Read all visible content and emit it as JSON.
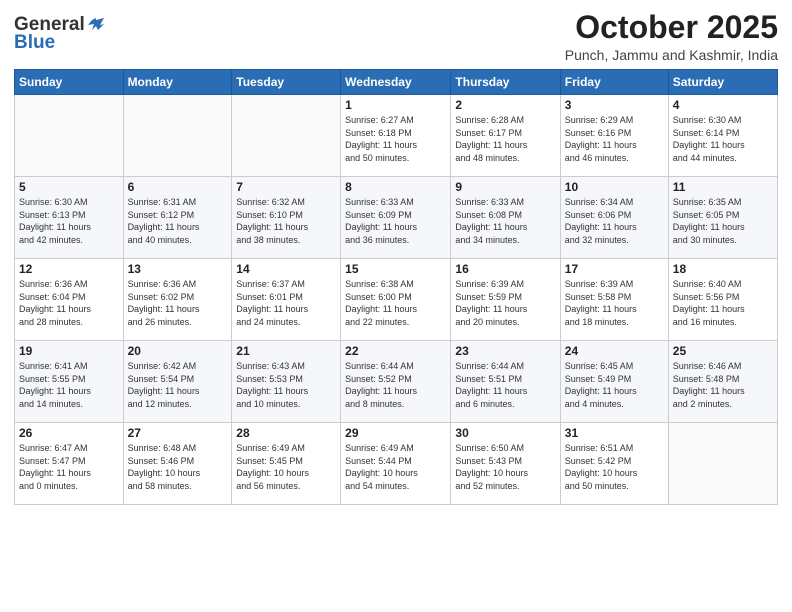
{
  "header": {
    "logo_general": "General",
    "logo_blue": "Blue",
    "month_title": "October 2025",
    "subtitle": "Punch, Jammu and Kashmir, India"
  },
  "days_of_week": [
    "Sunday",
    "Monday",
    "Tuesday",
    "Wednesday",
    "Thursday",
    "Friday",
    "Saturday"
  ],
  "weeks": [
    [
      {
        "num": "",
        "info": ""
      },
      {
        "num": "",
        "info": ""
      },
      {
        "num": "",
        "info": ""
      },
      {
        "num": "1",
        "info": "Sunrise: 6:27 AM\nSunset: 6:18 PM\nDaylight: 11 hours\nand 50 minutes."
      },
      {
        "num": "2",
        "info": "Sunrise: 6:28 AM\nSunset: 6:17 PM\nDaylight: 11 hours\nand 48 minutes."
      },
      {
        "num": "3",
        "info": "Sunrise: 6:29 AM\nSunset: 6:16 PM\nDaylight: 11 hours\nand 46 minutes."
      },
      {
        "num": "4",
        "info": "Sunrise: 6:30 AM\nSunset: 6:14 PM\nDaylight: 11 hours\nand 44 minutes."
      }
    ],
    [
      {
        "num": "5",
        "info": "Sunrise: 6:30 AM\nSunset: 6:13 PM\nDaylight: 11 hours\nand 42 minutes."
      },
      {
        "num": "6",
        "info": "Sunrise: 6:31 AM\nSunset: 6:12 PM\nDaylight: 11 hours\nand 40 minutes."
      },
      {
        "num": "7",
        "info": "Sunrise: 6:32 AM\nSunset: 6:10 PM\nDaylight: 11 hours\nand 38 minutes."
      },
      {
        "num": "8",
        "info": "Sunrise: 6:33 AM\nSunset: 6:09 PM\nDaylight: 11 hours\nand 36 minutes."
      },
      {
        "num": "9",
        "info": "Sunrise: 6:33 AM\nSunset: 6:08 PM\nDaylight: 11 hours\nand 34 minutes."
      },
      {
        "num": "10",
        "info": "Sunrise: 6:34 AM\nSunset: 6:06 PM\nDaylight: 11 hours\nand 32 minutes."
      },
      {
        "num": "11",
        "info": "Sunrise: 6:35 AM\nSunset: 6:05 PM\nDaylight: 11 hours\nand 30 minutes."
      }
    ],
    [
      {
        "num": "12",
        "info": "Sunrise: 6:36 AM\nSunset: 6:04 PM\nDaylight: 11 hours\nand 28 minutes."
      },
      {
        "num": "13",
        "info": "Sunrise: 6:36 AM\nSunset: 6:02 PM\nDaylight: 11 hours\nand 26 minutes."
      },
      {
        "num": "14",
        "info": "Sunrise: 6:37 AM\nSunset: 6:01 PM\nDaylight: 11 hours\nand 24 minutes."
      },
      {
        "num": "15",
        "info": "Sunrise: 6:38 AM\nSunset: 6:00 PM\nDaylight: 11 hours\nand 22 minutes."
      },
      {
        "num": "16",
        "info": "Sunrise: 6:39 AM\nSunset: 5:59 PM\nDaylight: 11 hours\nand 20 minutes."
      },
      {
        "num": "17",
        "info": "Sunrise: 6:39 AM\nSunset: 5:58 PM\nDaylight: 11 hours\nand 18 minutes."
      },
      {
        "num": "18",
        "info": "Sunrise: 6:40 AM\nSunset: 5:56 PM\nDaylight: 11 hours\nand 16 minutes."
      }
    ],
    [
      {
        "num": "19",
        "info": "Sunrise: 6:41 AM\nSunset: 5:55 PM\nDaylight: 11 hours\nand 14 minutes."
      },
      {
        "num": "20",
        "info": "Sunrise: 6:42 AM\nSunset: 5:54 PM\nDaylight: 11 hours\nand 12 minutes."
      },
      {
        "num": "21",
        "info": "Sunrise: 6:43 AM\nSunset: 5:53 PM\nDaylight: 11 hours\nand 10 minutes."
      },
      {
        "num": "22",
        "info": "Sunrise: 6:44 AM\nSunset: 5:52 PM\nDaylight: 11 hours\nand 8 minutes."
      },
      {
        "num": "23",
        "info": "Sunrise: 6:44 AM\nSunset: 5:51 PM\nDaylight: 11 hours\nand 6 minutes."
      },
      {
        "num": "24",
        "info": "Sunrise: 6:45 AM\nSunset: 5:49 PM\nDaylight: 11 hours\nand 4 minutes."
      },
      {
        "num": "25",
        "info": "Sunrise: 6:46 AM\nSunset: 5:48 PM\nDaylight: 11 hours\nand 2 minutes."
      }
    ],
    [
      {
        "num": "26",
        "info": "Sunrise: 6:47 AM\nSunset: 5:47 PM\nDaylight: 11 hours\nand 0 minutes."
      },
      {
        "num": "27",
        "info": "Sunrise: 6:48 AM\nSunset: 5:46 PM\nDaylight: 10 hours\nand 58 minutes."
      },
      {
        "num": "28",
        "info": "Sunrise: 6:49 AM\nSunset: 5:45 PM\nDaylight: 10 hours\nand 56 minutes."
      },
      {
        "num": "29",
        "info": "Sunrise: 6:49 AM\nSunset: 5:44 PM\nDaylight: 10 hours\nand 54 minutes."
      },
      {
        "num": "30",
        "info": "Sunrise: 6:50 AM\nSunset: 5:43 PM\nDaylight: 10 hours\nand 52 minutes."
      },
      {
        "num": "31",
        "info": "Sunrise: 6:51 AM\nSunset: 5:42 PM\nDaylight: 10 hours\nand 50 minutes."
      },
      {
        "num": "",
        "info": ""
      }
    ]
  ]
}
